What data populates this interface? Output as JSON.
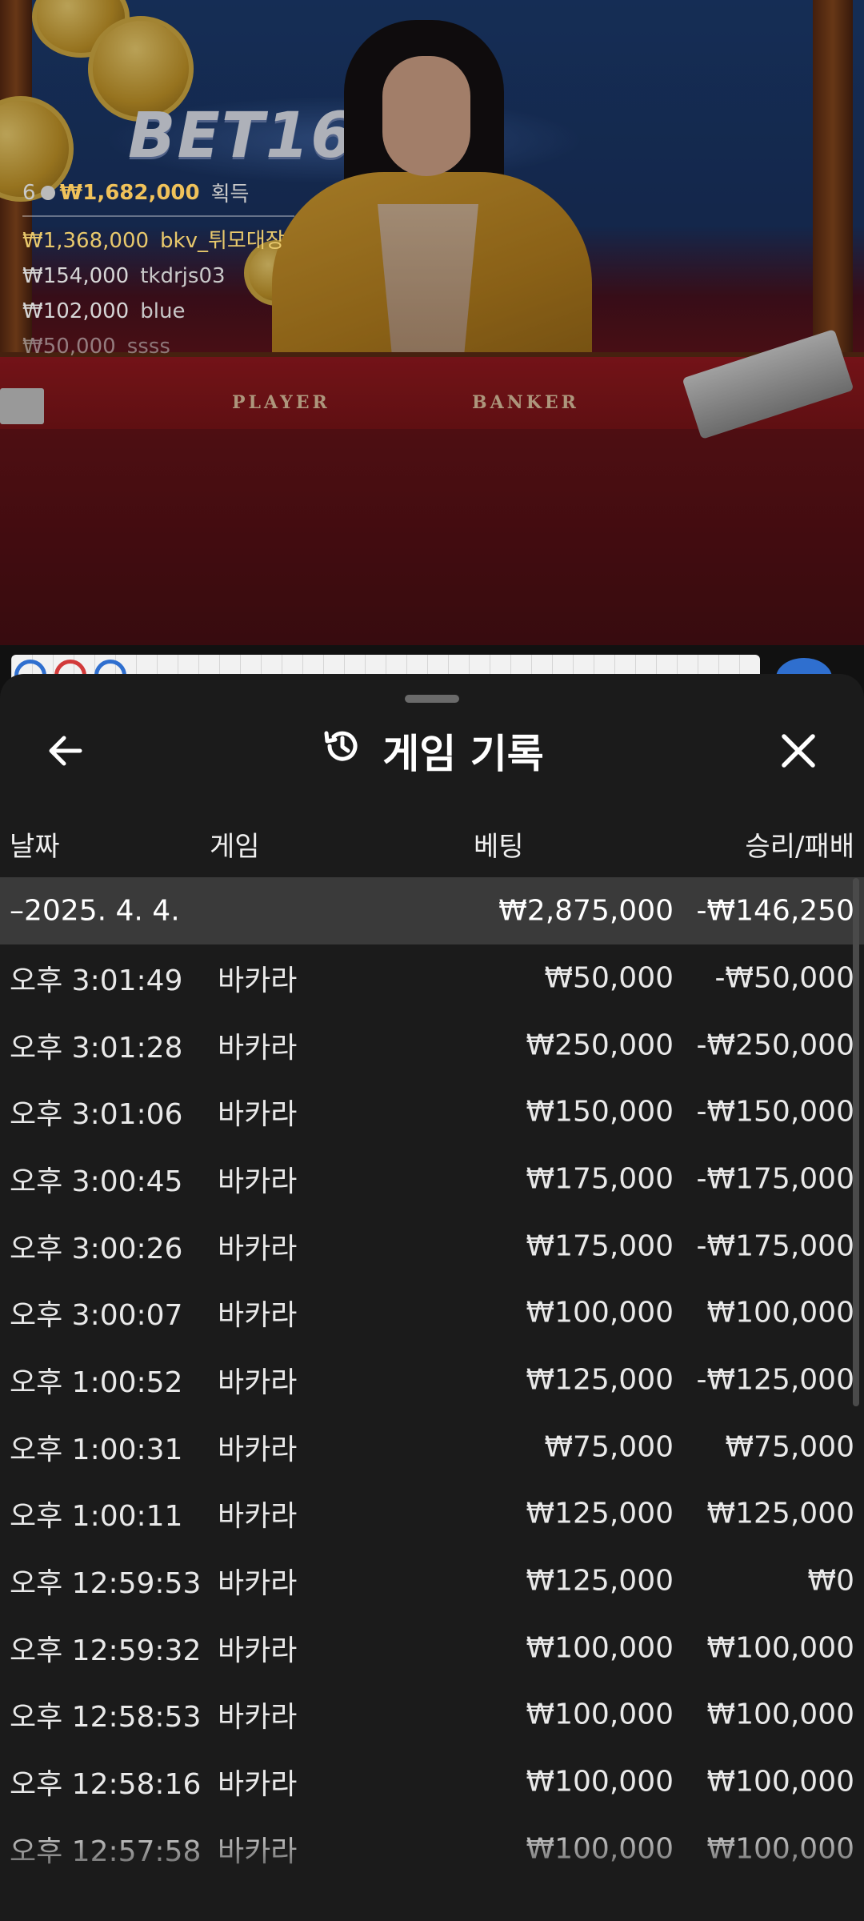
{
  "stream": {
    "logo": "BET16",
    "table_labels": {
      "player": "PLAYER",
      "banker": "BANKER"
    },
    "winners": {
      "count": "6",
      "total": "₩1,682,000",
      "suffix": "획득",
      "rows": [
        {
          "amount": "₩1,368,000",
          "name": "bkv_튀모대장"
        },
        {
          "amount": "₩154,000",
          "name": "tkdrjs03"
        },
        {
          "amount": "₩102,000",
          "name": "blue"
        },
        {
          "amount": "₩50,000",
          "name": "ssss"
        }
      ]
    }
  },
  "sheet": {
    "title": "게임 기록",
    "icons": {
      "back": "arrow-left-icon",
      "title": "history-icon",
      "close": "close-icon"
    },
    "columns": {
      "date": "날짜",
      "game": "게임",
      "bet": "베팅",
      "result": "승리/패배"
    },
    "group": {
      "date": "–2025. 4. 4.",
      "bet": "₩2,875,000",
      "result": "-₩146,250"
    },
    "rows": [
      {
        "time": "오후 3:01:49",
        "game": "바카라",
        "bet": "₩50,000",
        "result": "-₩50,000"
      },
      {
        "time": "오후 3:01:28",
        "game": "바카라",
        "bet": "₩250,000",
        "result": "-₩250,000"
      },
      {
        "time": "오후 3:01:06",
        "game": "바카라",
        "bet": "₩150,000",
        "result": "-₩150,000"
      },
      {
        "time": "오후 3:00:45",
        "game": "바카라",
        "bet": "₩175,000",
        "result": "-₩175,000"
      },
      {
        "time": "오후 3:00:26",
        "game": "바카라",
        "bet": "₩175,000",
        "result": "-₩175,000"
      },
      {
        "time": "오후 3:00:07",
        "game": "바카라",
        "bet": "₩100,000",
        "result": "₩100,000"
      },
      {
        "time": "오후 1:00:52",
        "game": "바카라",
        "bet": "₩125,000",
        "result": "-₩125,000"
      },
      {
        "time": "오후 1:00:31",
        "game": "바카라",
        "bet": "₩75,000",
        "result": "₩75,000"
      },
      {
        "time": "오후 1:00:11",
        "game": "바카라",
        "bet": "₩125,000",
        "result": "₩125,000"
      },
      {
        "time": "오후 12:59:53",
        "game": "바카라",
        "bet": "₩125,000",
        "result": "₩0"
      },
      {
        "time": "오후 12:59:32",
        "game": "바카라",
        "bet": "₩100,000",
        "result": "₩100,000"
      },
      {
        "time": "오후 12:58:53",
        "game": "바카라",
        "bet": "₩100,000",
        "result": "₩100,000"
      },
      {
        "time": "오후 12:58:16",
        "game": "바카라",
        "bet": "₩100,000",
        "result": "₩100,000"
      },
      {
        "time": "오후 12:57:58",
        "game": "바카라",
        "bet": "₩100,000",
        "result": "₩100,000"
      }
    ]
  },
  "colors": {
    "sheet_bg": "#1b1b1b",
    "group_row_bg": "#3a3a3a",
    "winner_gold": "#f0c25a",
    "road_player": "#2f6fcf",
    "road_banker": "#d23a3a"
  }
}
